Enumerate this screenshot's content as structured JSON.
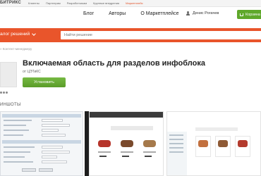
{
  "topbar": {
    "brand": "БИТРИКС",
    "links": [
      "Клиенты",
      "Партнерам",
      "Разработчикам",
      "Крупные внедрения",
      "Маркетплейс"
    ]
  },
  "nav": {
    "items": [
      "Блог",
      "Авторы",
      "О Маркетплейсе"
    ],
    "user_name": "Денис Рогачев",
    "cart_label": "Корзина"
  },
  "catalog": {
    "label": "алог решений",
    "search_placeholder": "Найти решение"
  },
  "breadcrumb": "» Контент-менеджеру",
  "product": {
    "title": "Включаемая область для разделов инфоблока",
    "vendor": "от ЦЭТиКС",
    "install_label": "Установить"
  },
  "screenshots": {
    "title": "ИНШОТЫ"
  },
  "colors": {
    "accent_orange": "#e9552b",
    "install_green": "#5fa82a"
  }
}
